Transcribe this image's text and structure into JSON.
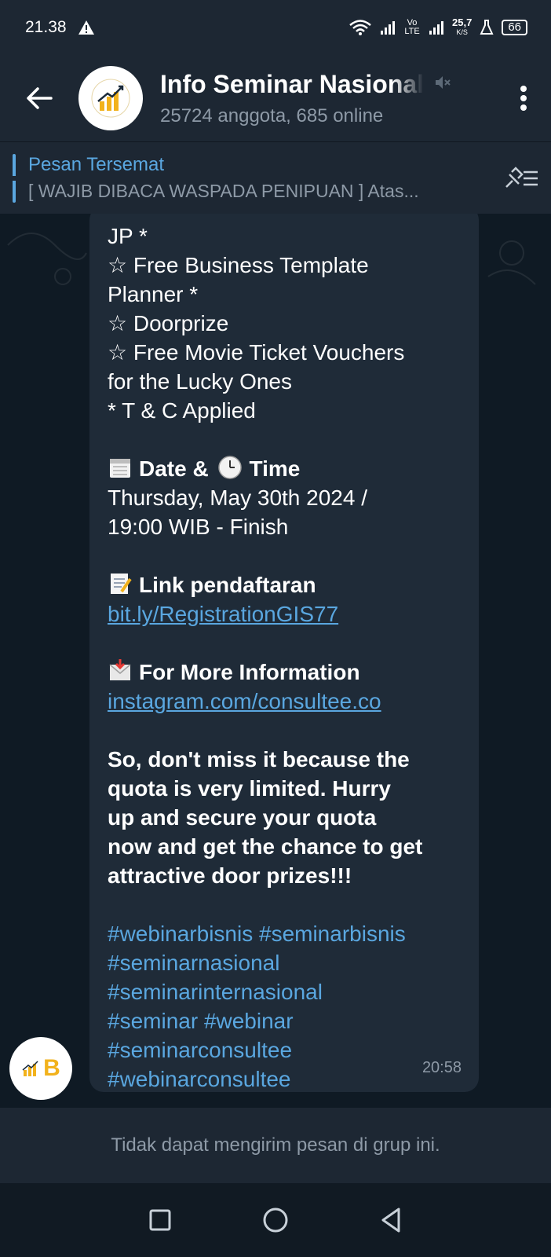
{
  "status_bar": {
    "time": "21.38",
    "net_speed": "25,7",
    "net_unit": "K/S",
    "volte": "Vo LTE",
    "battery": "66"
  },
  "header": {
    "title": "Info Seminar Nasional",
    "subtitle": "25724 anggota, 685 online"
  },
  "pinned": {
    "title": "Pesan Tersemat",
    "message": "[ WAJIB DIBACA WASPADA PENIPUAN ]  Atas..."
  },
  "message": {
    "lines": {
      "l1": "JP *",
      "l2": "☆ Free Business Template",
      "l3": "Planner *",
      "l4": "☆ Doorprize",
      "l5": "☆ Free Movie Ticket Vouchers",
      "l6": "for the Lucky Ones",
      "l7": "* T & C Applied"
    },
    "date_heading_a": "Date &",
    "date_heading_b": "Time",
    "date_line1": "Thursday, May 30th 2024 /",
    "date_line2": "19:00  WIB - Finish",
    "link_heading": "Link pendaftaran",
    "link_url": "bit.ly/RegistrationGIS77",
    "info_heading": "For More Information",
    "info_url": "instagram.com/consultee.co",
    "cta": {
      "l1": "So, don't miss it because the",
      "l2": "quota is very limited. Hurry",
      "l3": "up and secure your quota",
      "l4": "now and get the chance to get",
      "l5": "attractive door prizes!!!"
    },
    "tags": {
      "t1": "#webinarbisnis #seminarbisnis",
      "t2": "#seminarnasional",
      "t3": "#seminarinternasional",
      "t4": "#seminar #webinar",
      "t5": "#seminarconsultee",
      "t6": "#webinarconsultee"
    },
    "time": "20:58"
  },
  "sender_avatar_letter": "B",
  "footer_text": "Tidak dapat mengirim pesan di grup ini.",
  "colors": {
    "link": "#5aa7e0",
    "bubble": "#1f2b38",
    "header": "#1d2733"
  }
}
